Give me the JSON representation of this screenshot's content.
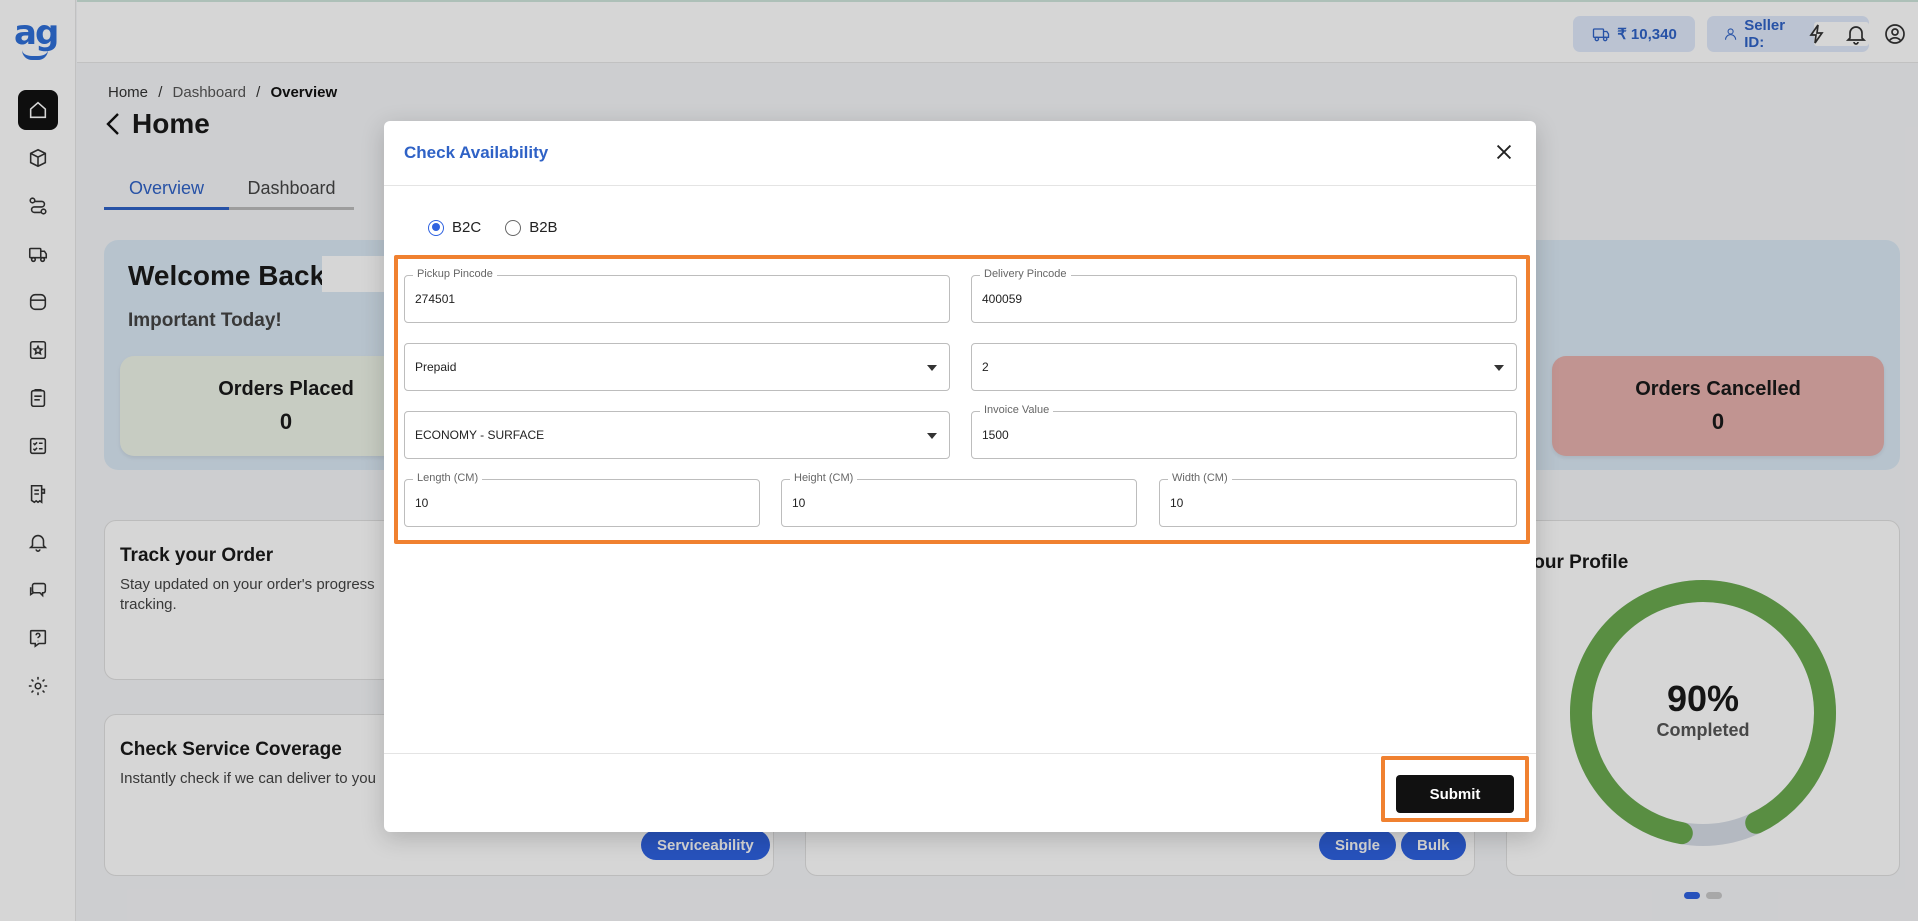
{
  "topbar": {
    "wallet_balance": "₹ 10,340",
    "seller_label": "Seller ID:"
  },
  "breadcrumb": {
    "home": "Home",
    "sep": "/",
    "dashboard": "Dashboard",
    "overview": "Overview"
  },
  "page": {
    "title": "Home",
    "tabs": [
      "Overview",
      "Dashboard"
    ]
  },
  "welcome": {
    "title": "Welcome Back,",
    "subtitle": "Important Today!",
    "orders_placed_label": "Orders Placed",
    "orders_placed_value": "0",
    "orders_cancelled_label": "Orders Cancelled",
    "orders_cancelled_value": "0"
  },
  "cards": {
    "track_title": "Track your Order",
    "track_desc": "Stay updated on your order's progress tracking.",
    "coverage_title": "Check Service Coverage",
    "coverage_desc": "Instantly check if we can deliver to you",
    "serviceability_btn": "Serviceability",
    "single_btn": "Single",
    "bulk_btn": "Bulk",
    "profile_title": "Your Profile",
    "profile_pct": "90%",
    "profile_pct_value": 90,
    "profile_label": "Completed"
  },
  "modal": {
    "title": "Check Availability",
    "radio_b2c": "B2C",
    "radio_b2b": "B2B",
    "selected_mode": "B2C",
    "pickup_label": "Pickup Pincode",
    "pickup_value": "274501",
    "delivery_label": "Delivery Pincode",
    "delivery_value": "400059",
    "payment_value": "Prepaid",
    "weight_value": "2",
    "service_value": "ECONOMY - SURFACE",
    "invoice_label": "Invoice Value",
    "invoice_value": "1500",
    "length_label": "Length (CM)",
    "length_value": "10",
    "height_label": "Height (CM)",
    "height_value": "10",
    "width_label": "Width (CM)",
    "width_value": "10",
    "submit_label": "Submit"
  },
  "colors": {
    "accent": "#2f62e0",
    "highlight": "#f08130",
    "orders_placed_bg": "#eef3e8",
    "orders_cancelled_bg": "#e6b1ad",
    "ring_fill": "#6aaa4f"
  },
  "icons": [
    "home-icon",
    "box-icon",
    "route-icon",
    "truck-icon",
    "wallet-icon",
    "star-icon",
    "clipboard-icon",
    "checklist-icon",
    "receipt-icon",
    "bell-icon",
    "chat-icon",
    "help-icon",
    "settings-icon",
    "flash-icon",
    "user-circle-icon",
    "close-icon",
    "back-arrow-icon"
  ]
}
